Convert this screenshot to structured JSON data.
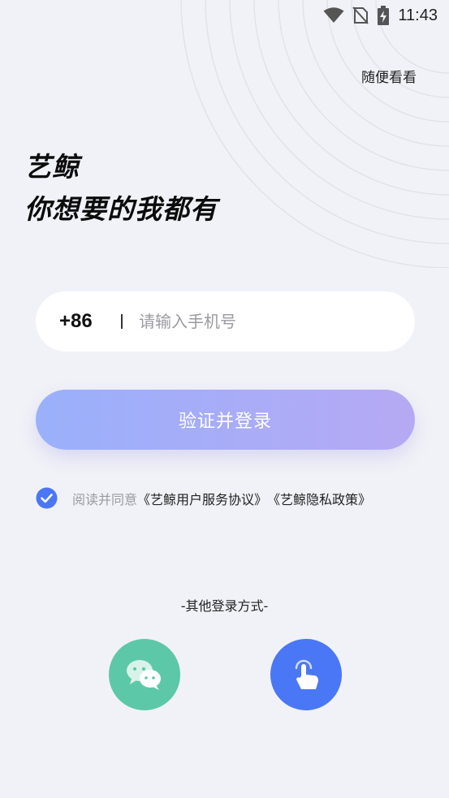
{
  "status_bar": {
    "time": "11:43"
  },
  "header": {
    "skip_label": "随便看看"
  },
  "slogan": {
    "line1": "艺鲸",
    "line2": "你想要的我都有"
  },
  "login_form": {
    "country_code": "+86",
    "phone_placeholder": "请输入手机号",
    "phone_value": "",
    "submit_label": "验证并登录"
  },
  "agreement": {
    "checked": true,
    "prefix": "阅读并同意",
    "service_link": "《艺鲸用户服务协议》",
    "privacy_link": "《艺鲸隐私政策》"
  },
  "other_login": {
    "title": "-其他登录方式-",
    "methods": [
      {
        "icon": "wechat-icon",
        "color": "#5cc8a8"
      },
      {
        "icon": "tap-icon",
        "color": "#4a77f5"
      }
    ]
  },
  "colors": {
    "background": "#f1f2f7",
    "accent_blue": "#4a77f5",
    "button_gradient_start": "#9ab0fb",
    "button_gradient_end": "#b6a9f4"
  }
}
